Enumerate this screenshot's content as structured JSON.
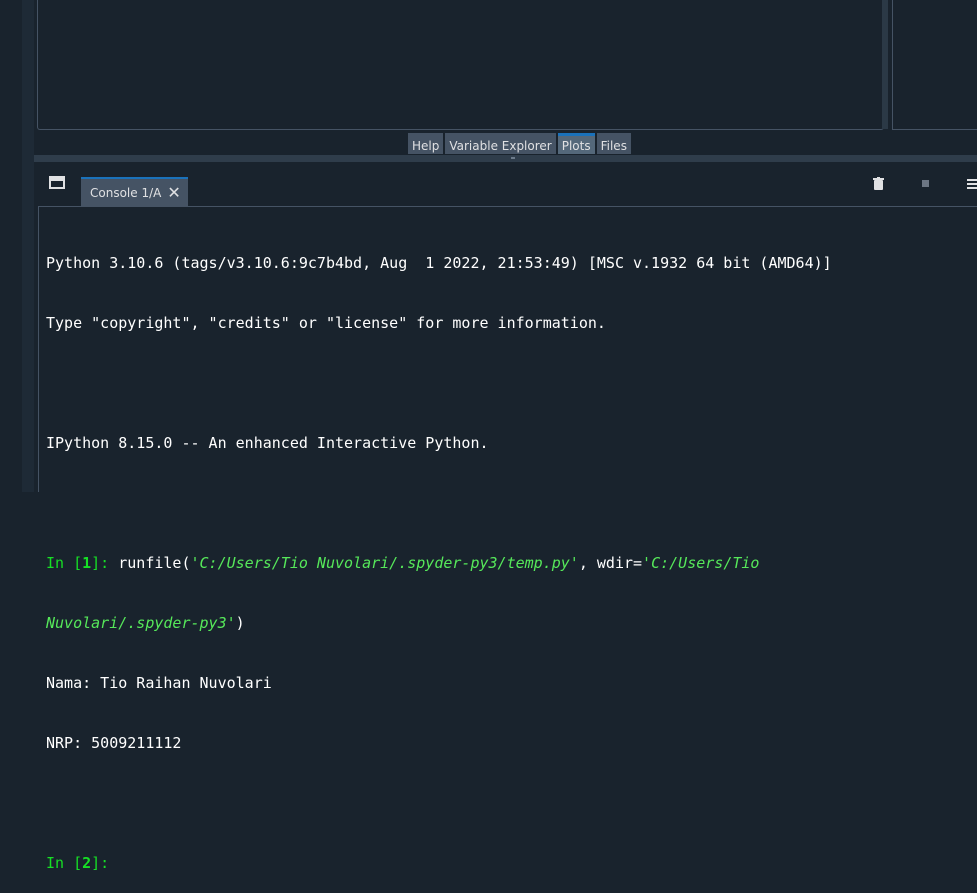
{
  "panes_tabs": [
    {
      "label": "Help",
      "active": false
    },
    {
      "label": "Variable Explorer",
      "active": false
    },
    {
      "label": "Plots",
      "active": true
    },
    {
      "label": "Files",
      "active": false
    }
  ],
  "console": {
    "tab_label": "Console 1/A",
    "close_glyph": "✕",
    "lines": {
      "l1": "Python 3.10.6 (tags/v3.10.6:9c7b4bd, Aug  1 2022, 21:53:49) [MSC v.1932 64 bit (AMD64)]",
      "l2": "Type \"copyright\", \"credits\" or \"license\" for more information.",
      "l4": "IPython 8.15.0 -- An enhanced Interactive Python.",
      "in1_prefix": "In [",
      "in1_num": "1",
      "in1_suffix": "]: ",
      "cmd_func": "runfile(",
      "cmd_path1": "'C:/Users/Tio Nuvolari/.spyder-py3/temp.py'",
      "cmd_mid": ", wdir=",
      "cmd_path2a": "'C:/Users/Tio",
      "cmd_path2b": "Nuvolari/.spyder-py3'",
      "cmd_close": ")",
      "out1": "Nama: Tio Raihan Nuvolari",
      "out2": "NRP: 5009211112",
      "in2_prefix": "In [",
      "in2_num": "2",
      "in2_suffix": "]:"
    }
  },
  "colors": {
    "background": "#19232d",
    "prompt_green": "#16e025",
    "string_green": "#56e85a",
    "tab_active_accent": "#1a72bb"
  },
  "icons": [
    "undock-icon",
    "close-icon",
    "trash-icon",
    "stop-icon",
    "menu-icon"
  ]
}
